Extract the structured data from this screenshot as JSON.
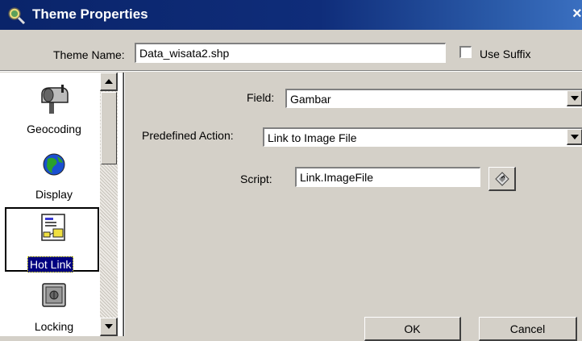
{
  "window": {
    "title": "Theme Properties",
    "close_glyph": "×"
  },
  "theme_name": {
    "label": "Theme Name:",
    "value": "Data_wisata2.shp"
  },
  "use_suffix": {
    "label": "Use Suffix",
    "checked": false
  },
  "categories": [
    {
      "label": "Geocoding",
      "icon": "mailbox-icon"
    },
    {
      "label": "Display",
      "icon": "globe-icon"
    },
    {
      "label": "Hot Link",
      "icon": "hotlink-icon",
      "selected": true
    },
    {
      "label": "Locking",
      "icon": "safe-icon"
    }
  ],
  "field": {
    "label": "Field:",
    "value": "Gambar"
  },
  "predefined_action": {
    "label": "Predefined Action:",
    "value": "Link to Image File"
  },
  "script": {
    "label": "Script:",
    "value": "Link.ImageFile"
  },
  "buttons": {
    "ok": "OK",
    "cancel": "Cancel"
  },
  "colors": {
    "title_bar": "#0a246a",
    "dialog_bg": "#d4d0c8",
    "selection": "#000080"
  }
}
